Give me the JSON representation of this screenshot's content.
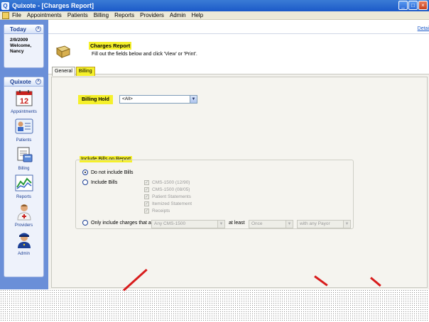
{
  "window": {
    "title": "Quixote - [Charges Report]",
    "controls": [
      "_",
      "□",
      "×"
    ]
  },
  "menubar": {
    "items": [
      "File",
      "Appointments",
      "Patients",
      "Billing",
      "Reports",
      "Providers",
      "Admin",
      "Help"
    ]
  },
  "sidebar": {
    "today": {
      "header": "Today",
      "date": "2/9/2009",
      "welcome": "Welcome,",
      "user": "Nancy"
    },
    "quixote": {
      "header": "Quixote",
      "items": [
        {
          "label": "Appointments",
          "icon": "calendar-icon",
          "badge": "12"
        },
        {
          "label": "Patients",
          "icon": "patient-card-icon"
        },
        {
          "label": "Billing",
          "icon": "billing-icon"
        },
        {
          "label": "Reports",
          "icon": "chart-icon"
        },
        {
          "label": "Providers",
          "icon": "doctor-icon"
        },
        {
          "label": "Admin",
          "icon": "admin-officer-icon"
        }
      ]
    }
  },
  "main": {
    "details_link": "Detai",
    "report_title": "Charges Report",
    "report_subtitle": "Fill out the fields below and click 'View' or 'Print'.",
    "tabs": [
      {
        "label": "General",
        "active": false
      },
      {
        "label": "Billing",
        "active": true
      }
    ],
    "billing_hold": {
      "label": "Billing Hold",
      "value": "<All>"
    },
    "include_bills_group": {
      "legend": "Include Bills on Report",
      "options": [
        {
          "label": "Do not include Bills",
          "selected": true
        },
        {
          "label": "Include Bills",
          "selected": false
        },
        {
          "label": "Only include charges that appear on a",
          "selected": false
        }
      ],
      "bill_types": [
        {
          "label": "CMS-1500 (12/90)",
          "checked": true
        },
        {
          "label": "CMS-1500 (08/05)",
          "checked": true
        },
        {
          "label": "Patient Statements",
          "checked": true
        },
        {
          "label": "Itemized Statement",
          "checked": true
        },
        {
          "label": "Receipts",
          "checked": true
        }
      ],
      "form_select": "Any CMS-1500",
      "at_least_label": "at least",
      "frequency_select": "Once",
      "payor_select": "with any Payor"
    }
  },
  "colors": {
    "highlight": "#f5f02a",
    "sidebar_bg": "#6a8fd8",
    "titlebar": "#1c5ac8",
    "annotation_marks": "#d81c1c"
  }
}
